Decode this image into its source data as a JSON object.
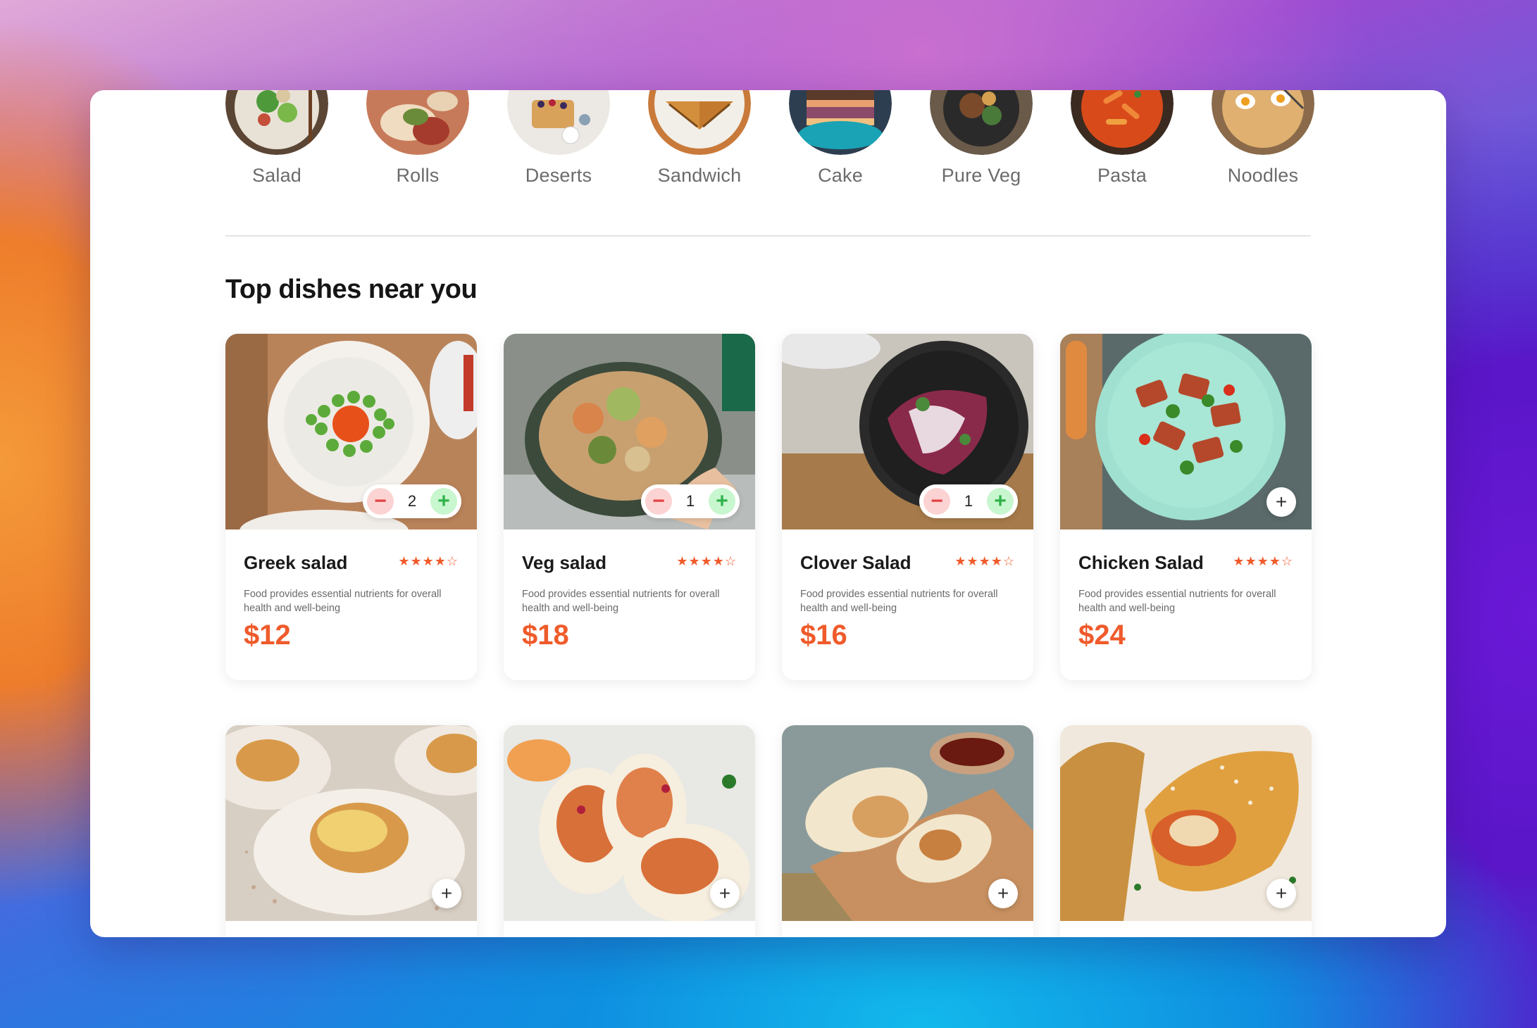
{
  "categories": [
    {
      "label": "Salad"
    },
    {
      "label": "Rolls"
    },
    {
      "label": "Deserts"
    },
    {
      "label": "Sandwich"
    },
    {
      "label": "Cake"
    },
    {
      "label": "Pure Veg"
    },
    {
      "label": "Pasta"
    },
    {
      "label": "Noodles"
    }
  ],
  "section": {
    "title": "Top dishes near you"
  },
  "dishes": [
    {
      "name": "Greek salad",
      "rating": "★★★★☆",
      "description": "Food provides essential nutrients for overall health and well-being",
      "price": "$12",
      "quantity": "2"
    },
    {
      "name": "Veg salad",
      "rating": "★★★★☆",
      "description": "Food provides essential nutrients for overall health and well-being",
      "price": "$18",
      "quantity": "1"
    },
    {
      "name": "Clover Salad",
      "rating": "★★★★☆",
      "description": "Food provides essential nutrients for overall health and well-being",
      "price": "$16",
      "quantity": "1"
    },
    {
      "name": "Chicken Salad",
      "rating": "★★★★☆",
      "description": "Food provides essential nutrients for overall health and well-being",
      "price": "$24"
    }
  ],
  "controls": {
    "minus": "−",
    "plus": "+",
    "add": "+"
  },
  "colors": {
    "accent": "#ef5b2b",
    "minus_bg": "#fcd3d3",
    "plus_bg": "#c8f6cf"
  }
}
